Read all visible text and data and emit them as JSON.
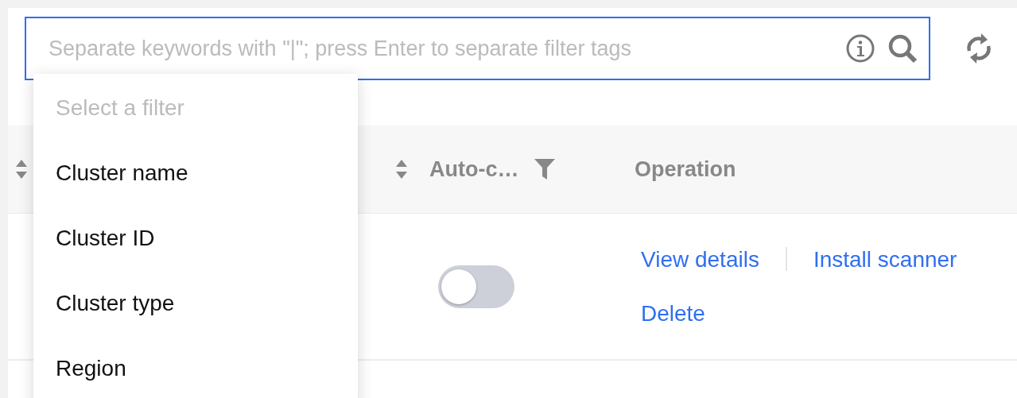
{
  "search": {
    "placeholder": "Separate keywords with \"|\"; press Enter to separate filter tags"
  },
  "table": {
    "columns": [
      {
        "kind": "sortable"
      },
      {
        "kind": "sortable"
      },
      {
        "kind": "filterable",
        "label": "Auto-c…"
      },
      {
        "kind": "plain",
        "label": "Operation"
      }
    ],
    "rows": [
      {
        "auto_scan": {
          "on": false
        },
        "actions": [
          "View details",
          "Install scanner",
          "Delete"
        ]
      }
    ]
  },
  "filter_menu": {
    "items": [
      {
        "kind": "header",
        "label": "Select a filter"
      },
      {
        "kind": "option",
        "label": "Cluster name"
      },
      {
        "kind": "option",
        "label": "Cluster ID"
      },
      {
        "kind": "option",
        "label": "Cluster type"
      },
      {
        "kind": "option",
        "label": "Region"
      }
    ]
  }
}
